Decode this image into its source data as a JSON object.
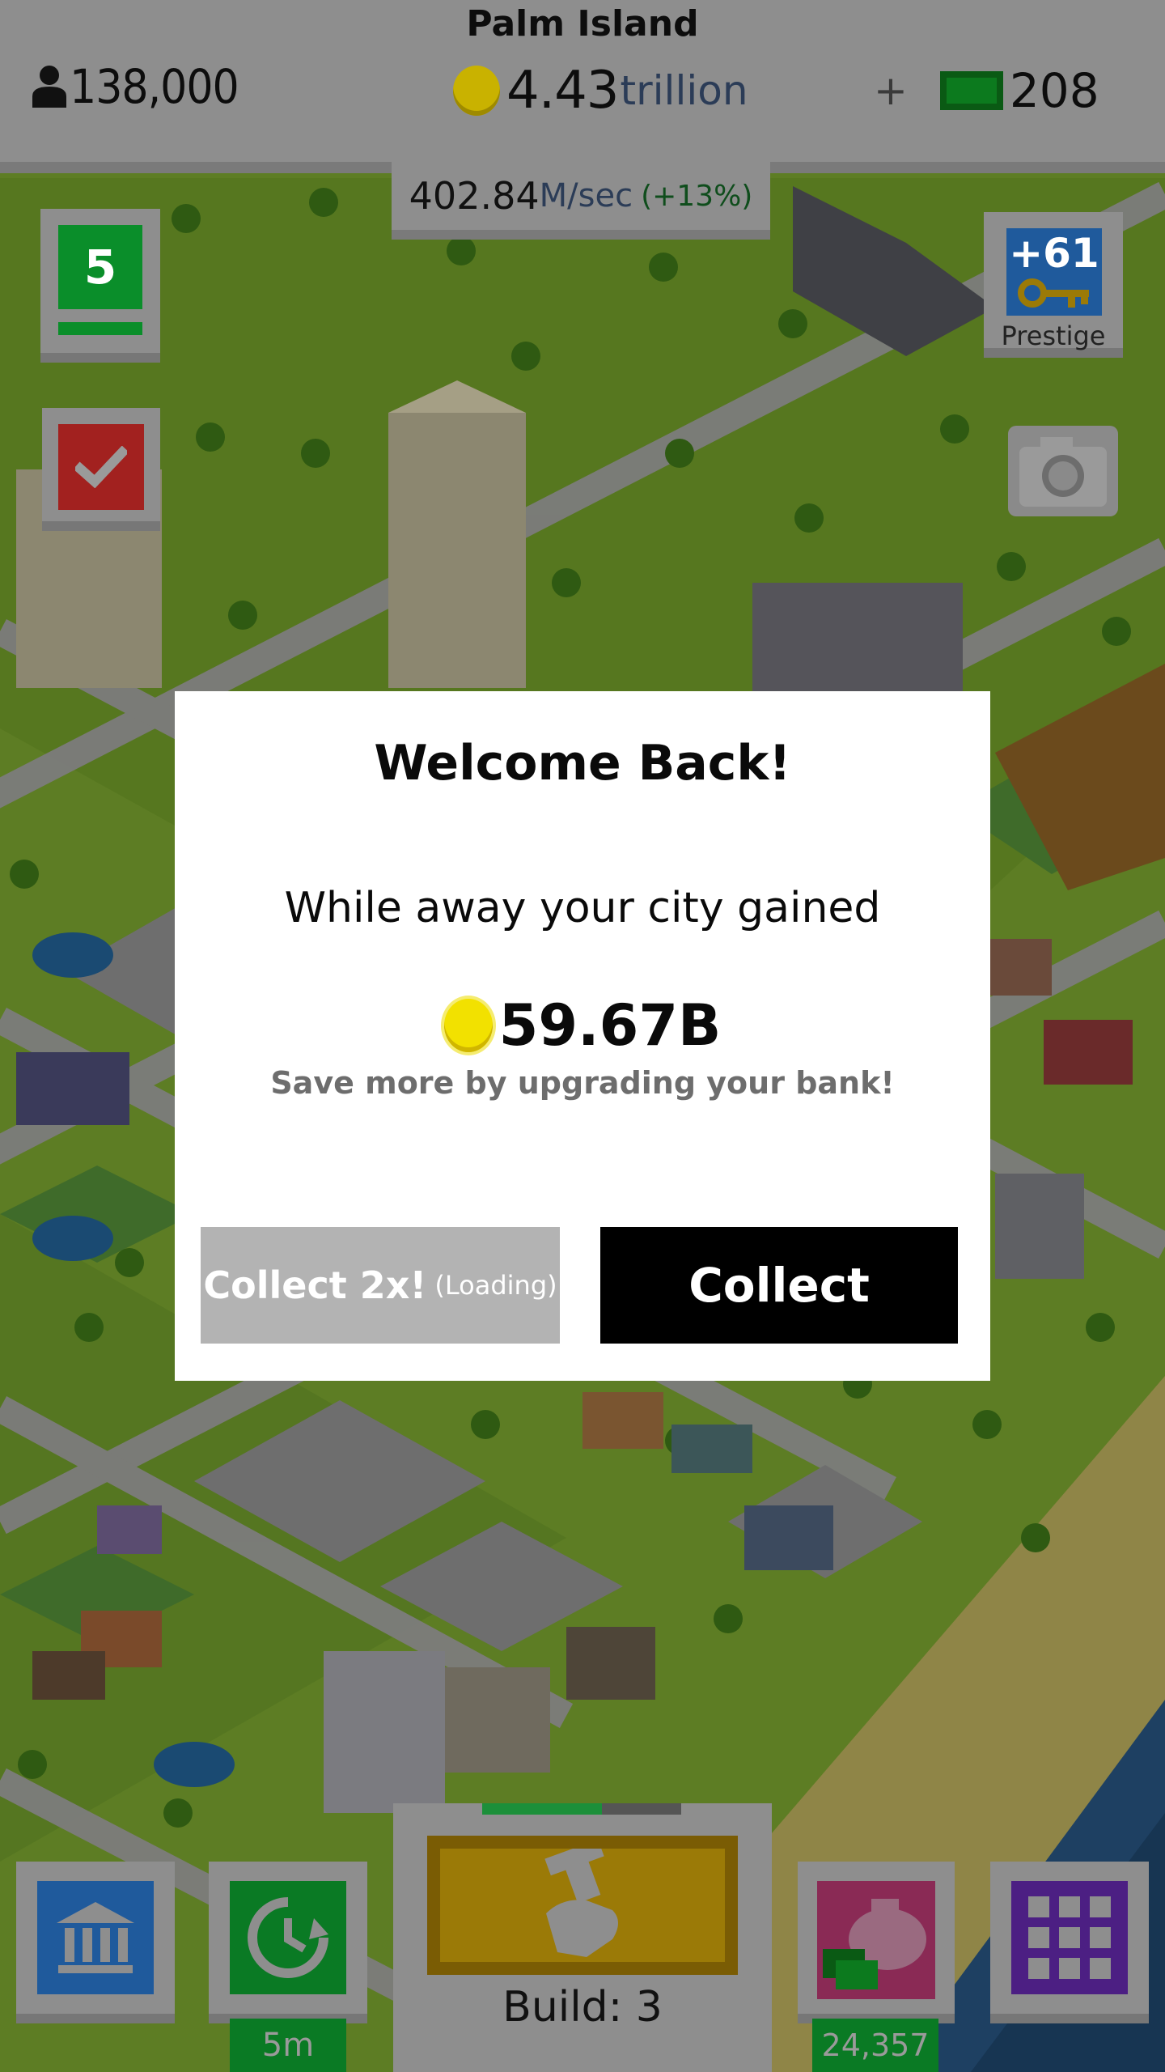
{
  "hud": {
    "city_name": "Palm Island",
    "population": "138,000",
    "money_amount": "4.43",
    "money_unit": "trillion",
    "cash_plus": "+",
    "cash_amount": "208",
    "income_rate": "402.84",
    "income_unit": "M/sec",
    "income_bonus": "(+13%)"
  },
  "side": {
    "level": "5",
    "tasks_icon": "checkmark-icon",
    "prestige_count": "+61",
    "prestige_label": "Prestige",
    "camera_icon": "camera-icon"
  },
  "bottom": {
    "bank_icon": "bank-icon",
    "boost_icon": "clock-refresh-icon",
    "boost_time": "5m",
    "build_label": "Build: 3",
    "build_progress": 0.6,
    "piggy_amount": "24,357",
    "menu_icon": "grid-icon"
  },
  "dialog": {
    "title": "Welcome Back!",
    "message": "While away your city gained",
    "amount": "59.67B",
    "hint": "Save more by upgrading your bank!",
    "collect2x_label": "Collect 2x!",
    "collect2x_sub": "(Loading)",
    "collect_label": "Collect"
  },
  "colors": {
    "overlay_hud": "#8e8e8e",
    "level_green": "#0a8e2a",
    "task_red": "#a2211f",
    "prestige_blue": "#1f5a9c",
    "build_gold": "#9b7a07",
    "piggy_pink": "#8a2a55",
    "menu_purple": "#4c1f83",
    "collect_black": "#000000",
    "collect2x_gray": "#b3b3b3"
  }
}
